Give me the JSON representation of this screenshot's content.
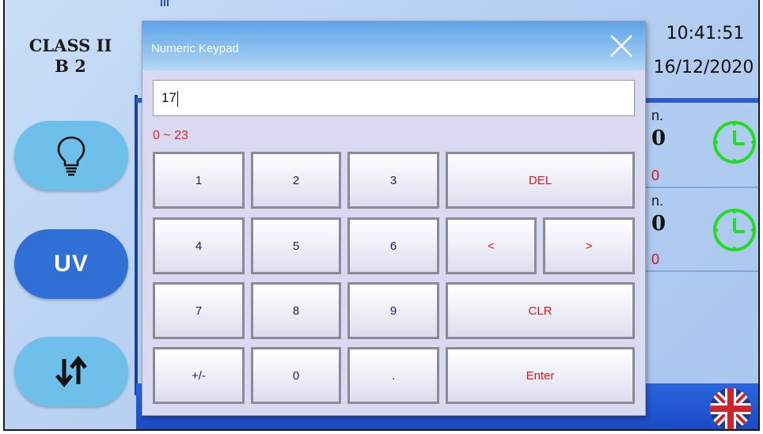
{
  "left_panel": {
    "class_label": "CLASS II",
    "class_type": "B 2",
    "buttons": [
      {
        "name": "light",
        "icon": "lightbulb-icon"
      },
      {
        "name": "uv",
        "label": "UV"
      },
      {
        "name": "airflow",
        "icon": "up-down-arrows-icon"
      }
    ]
  },
  "status": {
    "time": "10:41:51",
    "date": "16/12/2020",
    "rows": [
      {
        "unit_fragment": "n.",
        "value": "0",
        "sub_value": "0"
      },
      {
        "unit_fragment": "n.",
        "value": "0",
        "sub_value": "0"
      }
    ],
    "language_icon": "uk-flag-icon"
  },
  "keypad": {
    "title": "Numeric Keypad",
    "input_value": "17",
    "range_hint": "0 ~ 23",
    "keys": {
      "k1": "1",
      "k2": "2",
      "k3": "3",
      "k4": "4",
      "k5": "5",
      "k6": "6",
      "k7": "7",
      "k8": "8",
      "k9": "9",
      "plus_minus": "+/-",
      "k0": "0",
      "dot": ".",
      "del": "DEL",
      "left": "<",
      "right": ">",
      "clr": "CLR",
      "enter": "Enter"
    }
  },
  "colors": {
    "accent_blue": "#2f6fd6",
    "light_blue": "#6ec0ea",
    "warning_red": "#e01010",
    "timer_green": "#22dd22"
  }
}
